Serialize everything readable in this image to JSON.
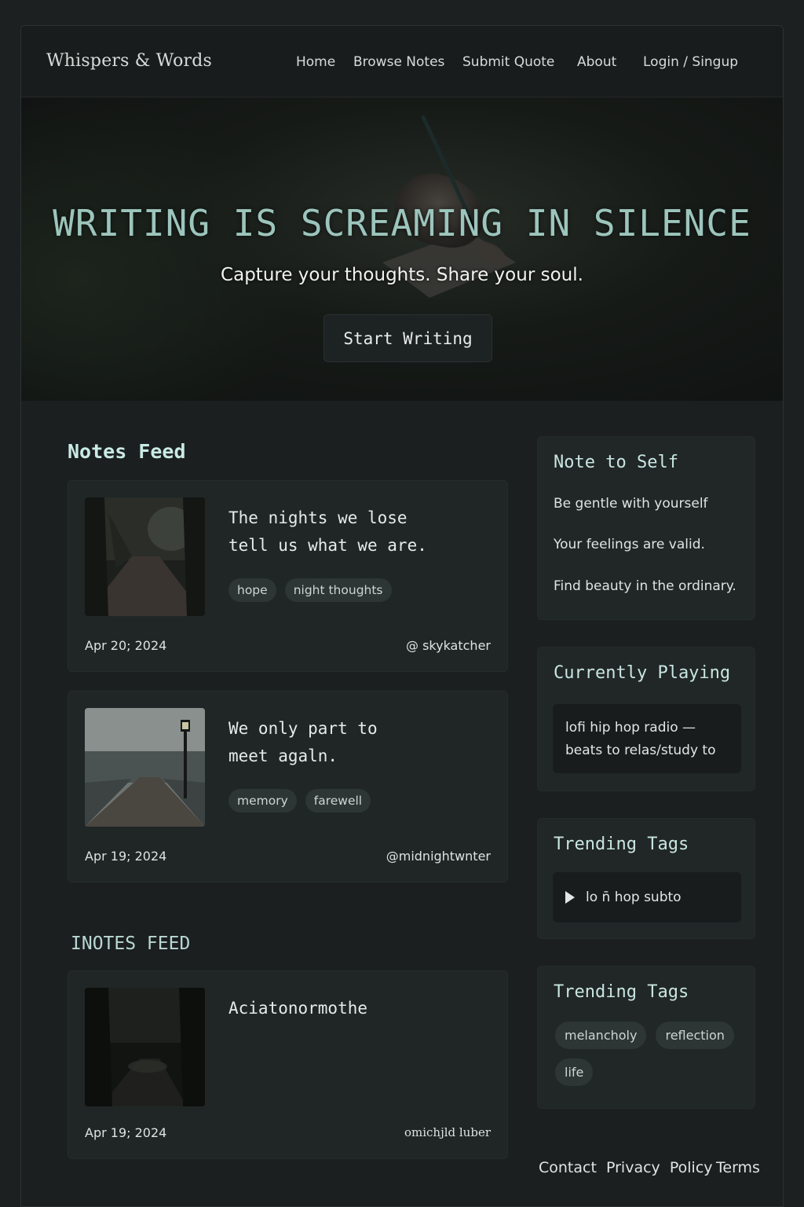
{
  "nav": {
    "brand": "Whispers & Words",
    "links": [
      "Home",
      "Browse Notes",
      "Submit Quote",
      "About",
      "Login / Singup"
    ]
  },
  "hero": {
    "title": "WRITING IS SCREAMING IN SILENCE",
    "subtitle": "Capture your thoughts. Share your soul.",
    "button": "Start Writing"
  },
  "feed": {
    "title": "Notes Feed",
    "title_secondary": "INOTES FEED",
    "notes": [
      {
        "quote": "The nights we lose\ntell us what we are.",
        "tags": [
          "hope",
          "night thoughts"
        ],
        "date": "Apr 20; 2024",
        "author": "@ skykatcher"
      },
      {
        "quote": "We only part to\nmeet agaln.",
        "tags": [
          "memory",
          "farewell"
        ],
        "date": "Apr 19; 2024",
        "author": "@midnightwnter"
      },
      {
        "quote": "Aciatonormothe",
        "tags": [],
        "date": "Apr 19; 2024",
        "author": "omichjld luber"
      }
    ]
  },
  "sidebar": {
    "note_to_self": {
      "title": "Note to Self",
      "lines": [
        "Be gentle with yourself",
        "Your feelings are valid.",
        "Find beauty in the ordinary."
      ]
    },
    "currently_playing": {
      "title": "Currently Playing",
      "track": "lofi hip hop radio —\nbeats to relas/study to"
    },
    "trending_player": {
      "title": "Trending Tags",
      "track": "lo  n̄  hop subto"
    },
    "trending_tags": {
      "title": "Trending Tags",
      "tags": [
        "melancholy",
        "reflection",
        "life"
      ]
    }
  },
  "footer": {
    "links": [
      "Contact",
      "Privacy  Policy",
      "Terms"
    ]
  },
  "colors": {
    "background": "#1b1f1f",
    "accent": "#9cc5bc",
    "card": "#202626",
    "tag": "#2d3535"
  }
}
